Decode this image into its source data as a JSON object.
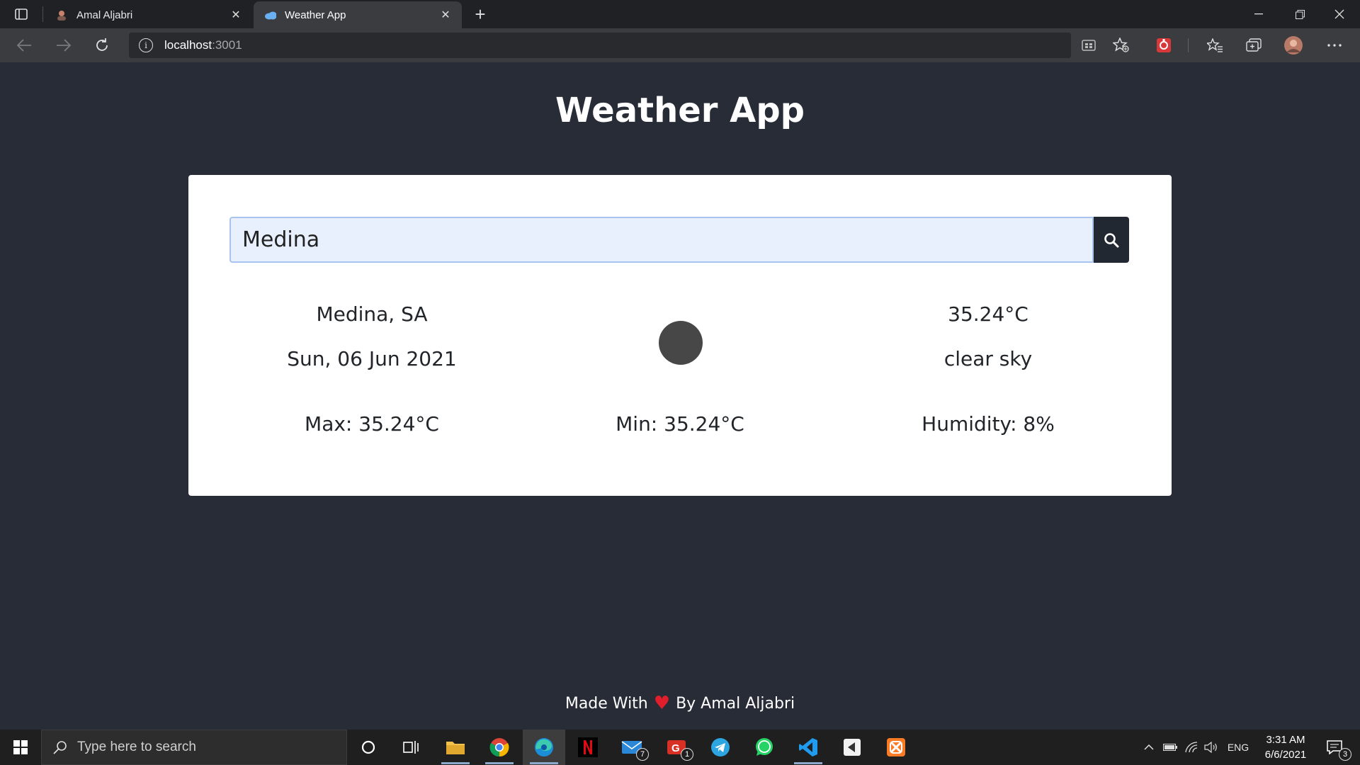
{
  "browser": {
    "tabs": [
      {
        "title": "Amal Aljabri",
        "active": false
      },
      {
        "title": "Weather App",
        "active": true
      }
    ],
    "address": {
      "host": "localhost",
      "port": ":3001"
    }
  },
  "app": {
    "title": "Weather App",
    "search": {
      "value": "Medina"
    },
    "weather": {
      "location": "Medina, SA",
      "date": "Sun, 06 Jun 2021",
      "temperature": "35.24°C",
      "description": "clear sky",
      "max": "Max: 35.24°C",
      "min": "Min: 35.24°C",
      "humidity": "Humidity: 8%"
    },
    "footer": {
      "before": "Made With",
      "after": "By Amal Aljabri"
    }
  },
  "taskbar": {
    "search_placeholder": "Type here to search",
    "mail_badge": "7",
    "gmail_badge": "1",
    "language": "ENG",
    "time": "3:31 AM",
    "date": "6/6/2021",
    "notifications": "3"
  },
  "colors": {
    "page_bg": "#272c36",
    "card_bg": "#ffffff",
    "search_btn_bg": "#222831",
    "input_bg": "#e8f0fe",
    "heart": "#e01e2c"
  }
}
